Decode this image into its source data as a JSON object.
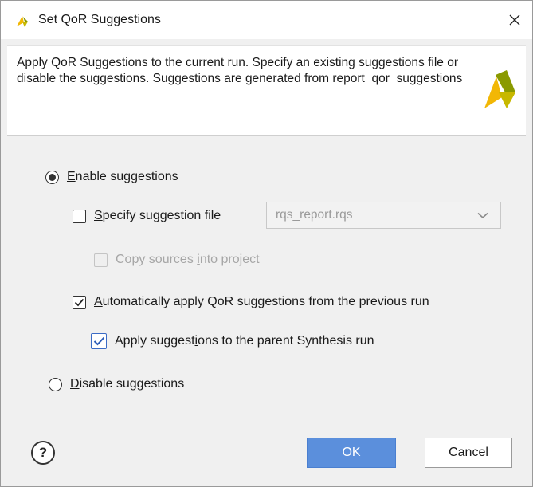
{
  "dialog": {
    "title": "Set QoR Suggestions",
    "description": "Apply QoR Suggestions to the current run. Specify an existing suggestions file or disable the suggestions. Suggestions are generated from report_qor_suggestions"
  },
  "options": {
    "enable": {
      "first": "E",
      "rest": "nable suggestions",
      "selected": true
    },
    "specify_file": {
      "first": "S",
      "rest": "pecify suggestion file",
      "checked": false
    },
    "file_combo": {
      "value": "rqs_report.rqs",
      "enabled": false
    },
    "copy_sources": {
      "before": "Copy sources ",
      "ul": "i",
      "after": "nto project",
      "checked": false,
      "enabled": false
    },
    "auto_apply": {
      "first": "A",
      "rest": "utomatically apply QoR suggestions from the previous run",
      "checked": true
    },
    "apply_parent": {
      "before": "Apply suggest",
      "ul": "i",
      "after": "ons to the parent Synthesis run",
      "checked": true
    },
    "disable": {
      "first": "D",
      "rest": "isable suggestions",
      "selected": false
    }
  },
  "buttons": {
    "help": "?",
    "ok": "OK",
    "cancel": "Cancel"
  },
  "icons": {
    "title": "vivado-logo-icon",
    "header_logo": "vivado-logo-icon",
    "close": "close-icon",
    "dropdown": "chevron-down-icon",
    "check": "checkmark-icon"
  },
  "colors": {
    "ok_button": "#5b8fdc",
    "checkbox_accent": "#3b6bc5",
    "logo_light": "#f2b705",
    "logo_mid": "#c7b800",
    "logo_dark": "#8a9a00"
  }
}
